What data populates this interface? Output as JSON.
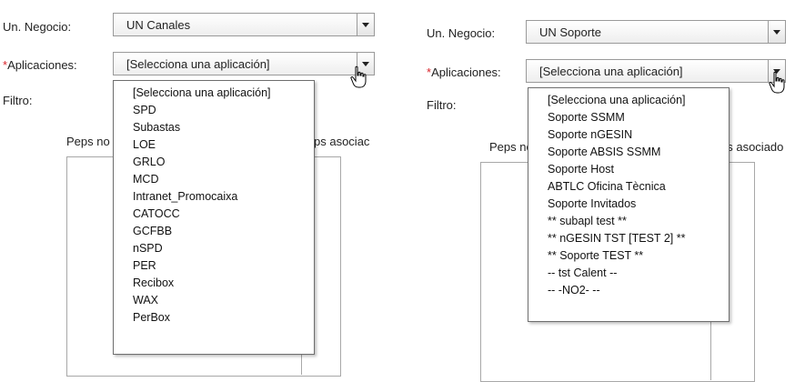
{
  "left": {
    "un_negocio_label": "Un. Negocio:",
    "un_negocio_value": "UN Canales",
    "aplicaciones_required_mark": "*",
    "aplicaciones_label": "Aplicaciones:",
    "aplicaciones_value": "[Selecciona una aplicación]",
    "filtro_label": "Filtro:",
    "peps_no_label": "Peps no",
    "peps_asociados_label": "ps asociac",
    "dropdown_options": [
      "[Selecciona una aplicación]",
      "SPD",
      "Subastas",
      "LOE",
      "GRLO",
      "MCD",
      "Intranet_Promocaixa",
      "CATOCC",
      "GCFBB",
      "nSPD",
      "PER",
      "Recibox",
      "WAX",
      "PerBox"
    ]
  },
  "right": {
    "un_negocio_label": "Un. Negocio:",
    "un_negocio_value": "UN Soporte",
    "aplicaciones_required_mark": "*",
    "aplicaciones_label": "Aplicaciones:",
    "aplicaciones_value": "[Selecciona una aplicación]",
    "filtro_label": "Filtro:",
    "peps_no_label": "Peps no",
    "peps_asociados_label": "ps asociado",
    "dropdown_options": [
      "[Selecciona una aplicación]",
      "Soporte SSMM",
      "Soporte nGESIN",
      "Soporte ABSIS SSMM",
      "Soporte Host",
      "ABTLC Oficina Tècnica",
      "Soporte Invitados",
      "** subapl test **",
      "** nGESIN TST [TEST 2] **",
      "** Soporte TEST **",
      "-- tst Calent --",
      "-- -NO2- --"
    ]
  },
  "colors": {
    "required": "#d9232a",
    "border": "#9a9a9a"
  },
  "icons": {
    "cursor": "hand-pointer-icon",
    "dropdown_arrow": "triangle-down-icon"
  }
}
